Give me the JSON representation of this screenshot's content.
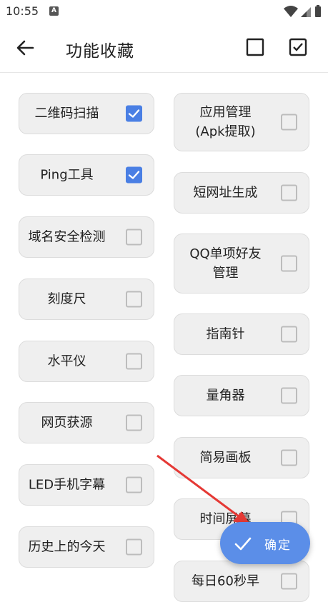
{
  "status": {
    "time": "10:55",
    "notif_letter": "A"
  },
  "appbar": {
    "title": "功能收藏"
  },
  "left_items": [
    {
      "label": "二维码扫描",
      "checked": true
    },
    {
      "label": "Ping工具",
      "checked": true
    },
    {
      "label": "域名安全检测",
      "checked": false
    },
    {
      "label": "刻度尺",
      "checked": false
    },
    {
      "label": "水平仪",
      "checked": false
    },
    {
      "label": "网页获源",
      "checked": false
    },
    {
      "label": "LED手机字幕",
      "checked": false
    },
    {
      "label": "历史上的今天",
      "checked": false
    }
  ],
  "right_items": [
    {
      "label": "应用管理\n(Apk提取)",
      "checked": false
    },
    {
      "label": "短网址生成",
      "checked": false
    },
    {
      "label": "QQ单项好友\n管理",
      "checked": false
    },
    {
      "label": "指南针",
      "checked": false
    },
    {
      "label": "量角器",
      "checked": false
    },
    {
      "label": "简易画板",
      "checked": false
    },
    {
      "label": "时间屏幕",
      "checked": false
    },
    {
      "label": "每日60秒早",
      "checked": false
    }
  ],
  "fab": {
    "label": "确定"
  },
  "colors": {
    "accent": "#4a7fe4",
    "fab": "#5b8ee8",
    "card": "#efefef",
    "annotation_arrow": "#e53935"
  }
}
